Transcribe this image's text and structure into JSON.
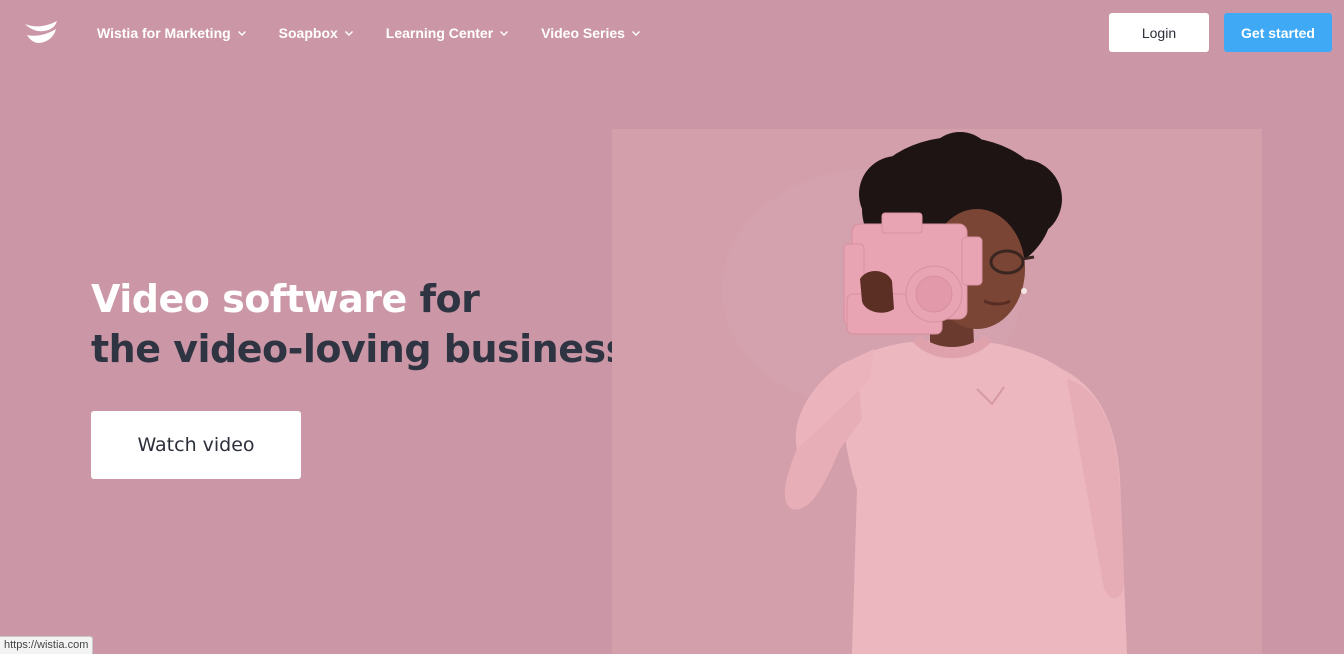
{
  "header": {
    "logo_icon": "wistia-logo-icon",
    "nav": [
      {
        "label": "Wistia for Marketing"
      },
      {
        "label": "Soapbox"
      },
      {
        "label": "Learning Center"
      },
      {
        "label": "Video Series"
      }
    ],
    "login_label": "Login",
    "get_started_label": "Get started"
  },
  "hero": {
    "headline_highlight": "Video software",
    "headline_rest_line1": " for",
    "headline_line2": "the video-loving business",
    "watch_video_label": "Watch video"
  },
  "media": {
    "icon": "woman-with-camera-image"
  },
  "status_bar": {
    "url": "https://wistia.com"
  },
  "colors": {
    "background": "#cb97a6",
    "media_panel": "#d29faa",
    "accent_button": "#3fa9f5",
    "headline_dark": "#2f3442",
    "headline_highlight": "#ffffff"
  }
}
